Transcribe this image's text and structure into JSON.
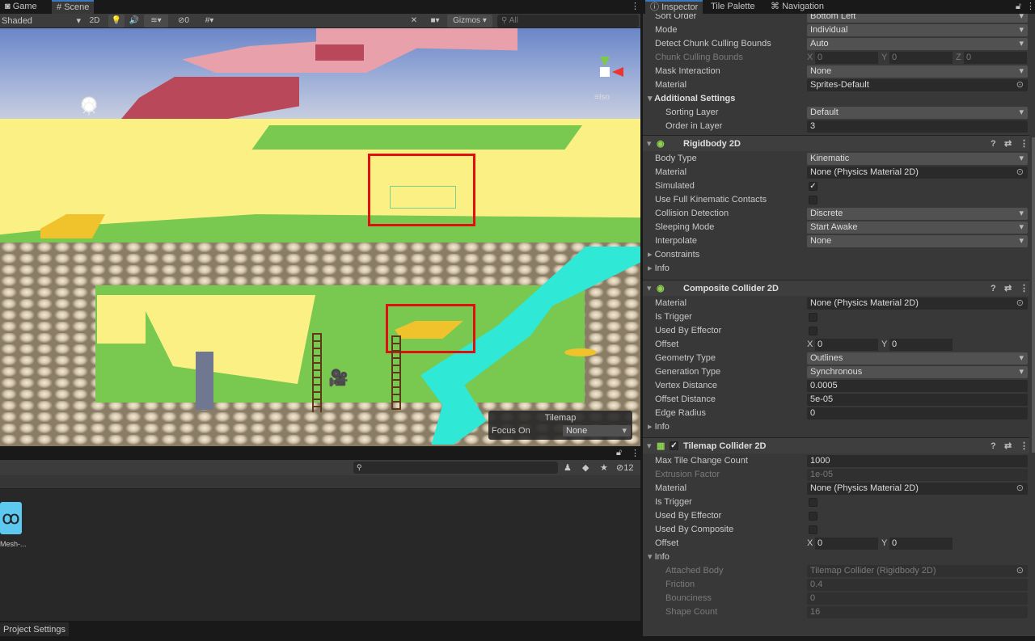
{
  "scene_tabs": [
    {
      "label": "Game",
      "icon": "gamepad-icon"
    },
    {
      "label": "Scene",
      "icon": "grid-icon"
    }
  ],
  "toolbar": {
    "draw_mode": "Shaded",
    "mode_2d": "2D",
    "hidden_count": "0",
    "gizmos": "Gizmos",
    "search_placeholder": "All"
  },
  "scene": {
    "iso_label": "Iso",
    "overlay": {
      "title": "Tilemap",
      "focus_label": "Focus On",
      "focus_value": "None"
    }
  },
  "project": {
    "hidden_count": "12",
    "asset_name": "Mesh-...",
    "bottom_tab": "Project Settings"
  },
  "inspector": {
    "tabs": [
      "Inspector",
      "Tile Palette",
      "Navigation"
    ],
    "tilemap_renderer": [
      {
        "label": "Sort Order",
        "type": "dropdown",
        "value": "Bottom Left"
      },
      {
        "label": "Mode",
        "type": "dropdown",
        "value": "Individual"
      },
      {
        "label": "Detect Chunk Culling Bounds",
        "type": "dropdown",
        "value": "Auto"
      },
      {
        "label": "Chunk Culling Bounds",
        "type": "xyz",
        "disabled": true,
        "x": "0",
        "y": "0",
        "z": "0"
      },
      {
        "label": "Mask Interaction",
        "type": "dropdown",
        "value": "None"
      },
      {
        "label": "Material",
        "type": "object",
        "value": "Sprites-Default"
      },
      {
        "label": "Additional Settings",
        "type": "section"
      },
      {
        "label": "Sorting Layer",
        "type": "dropdown",
        "value": "Default",
        "indent": true
      },
      {
        "label": "Order in Layer",
        "type": "field",
        "value": "3",
        "indent": true
      }
    ],
    "components": [
      {
        "title": "Rigidbody 2D",
        "rows": [
          {
            "label": "Body Type",
            "type": "dropdown",
            "value": "Kinematic"
          },
          {
            "label": "Material",
            "type": "object",
            "value": "None (Physics Material 2D)"
          },
          {
            "label": "Simulated",
            "type": "check",
            "checked": true
          },
          {
            "label": "Use Full Kinematic Contacts",
            "type": "check",
            "checked": false
          },
          {
            "label": "Collision Detection",
            "type": "dropdown",
            "value": "Discrete"
          },
          {
            "label": "Sleeping Mode",
            "type": "dropdown",
            "value": "Start Awake"
          },
          {
            "label": "Interpolate",
            "type": "dropdown",
            "value": "None"
          },
          {
            "label": "Constraints",
            "type": "fold"
          },
          {
            "label": "Info",
            "type": "fold"
          }
        ]
      },
      {
        "title": "Composite Collider 2D",
        "rows": [
          {
            "label": "Material",
            "type": "object",
            "value": "None (Physics Material 2D)"
          },
          {
            "label": "Is Trigger",
            "type": "check",
            "checked": false
          },
          {
            "label": "Used By Effector",
            "type": "check",
            "checked": false
          },
          {
            "label": "Offset",
            "type": "xy",
            "x": "0",
            "y": "0"
          },
          {
            "label": "Geometry Type",
            "type": "dropdown",
            "value": "Outlines"
          },
          {
            "label": "Generation Type",
            "type": "dropdown",
            "value": "Synchronous"
          },
          {
            "label": "Vertex Distance",
            "type": "field",
            "value": "0.0005"
          },
          {
            "label": "Offset Distance",
            "type": "field",
            "value": "5e-05"
          },
          {
            "label": "Edge Radius",
            "type": "field",
            "value": "0"
          },
          {
            "label": "Info",
            "type": "fold"
          }
        ]
      },
      {
        "title": "Tilemap Collider 2D",
        "enabled": true,
        "rows": [
          {
            "label": "Max Tile Change Count",
            "type": "field",
            "value": "1000"
          },
          {
            "label": "Extrusion Factor",
            "type": "field",
            "value": "1e-05",
            "disabled": true
          },
          {
            "label": "Material",
            "type": "object",
            "value": "None (Physics Material 2D)"
          },
          {
            "label": "Is Trigger",
            "type": "check",
            "checked": false
          },
          {
            "label": "Used By Effector",
            "type": "check",
            "checked": false
          },
          {
            "label": "Used By Composite",
            "type": "check",
            "checked": false
          },
          {
            "label": "Offset",
            "type": "xy",
            "x": "0",
            "y": "0"
          },
          {
            "label": "Info",
            "type": "foldopen"
          },
          {
            "label": "Attached Body",
            "type": "object",
            "value": "Tilemap Collider (Rigidbody 2D)",
            "disabled": true,
            "indent": true
          },
          {
            "label": "Friction",
            "type": "field",
            "value": "0.4",
            "disabled": true,
            "indent": true
          },
          {
            "label": "Bounciness",
            "type": "field",
            "value": "0",
            "disabled": true,
            "indent": true
          },
          {
            "label": "Shape Count",
            "type": "field",
            "value": "16",
            "disabled": true,
            "indent": true
          }
        ]
      }
    ]
  }
}
